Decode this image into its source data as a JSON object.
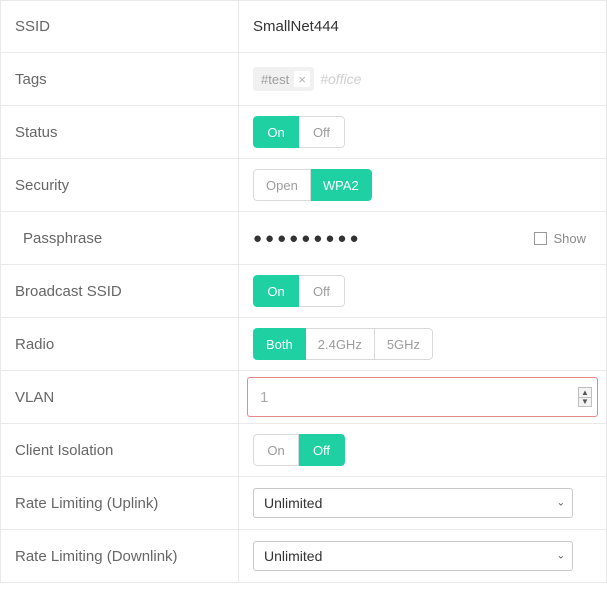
{
  "ssid": {
    "label": "SSID",
    "value": "SmallNet444"
  },
  "tags": {
    "label": "Tags",
    "items": [
      "#test"
    ],
    "placeholder": "#office"
  },
  "status": {
    "label": "Status",
    "options": [
      "On",
      "Off"
    ],
    "value": "On"
  },
  "security": {
    "label": "Security",
    "options": [
      "Open",
      "WPA2"
    ],
    "value": "WPA2"
  },
  "passphrase": {
    "label": "Passphrase",
    "masked": "●●●●●●●●●",
    "show_label": "Show",
    "show_checked": false
  },
  "broadcast": {
    "label": "Broadcast SSID",
    "options": [
      "On",
      "Off"
    ],
    "value": "On"
  },
  "radio": {
    "label": "Radio",
    "options": [
      "Both",
      "2.4GHz",
      "5GHz"
    ],
    "value": "Both"
  },
  "vlan": {
    "label": "VLAN",
    "value": "1"
  },
  "isolation": {
    "label": "Client Isolation",
    "options": [
      "On",
      "Off"
    ],
    "value": "Off"
  },
  "rate_up": {
    "label": "Rate Limiting (Uplink)",
    "value": "Unlimited"
  },
  "rate_down": {
    "label": "Rate Limiting (Downlink)",
    "value": "Unlimited"
  }
}
